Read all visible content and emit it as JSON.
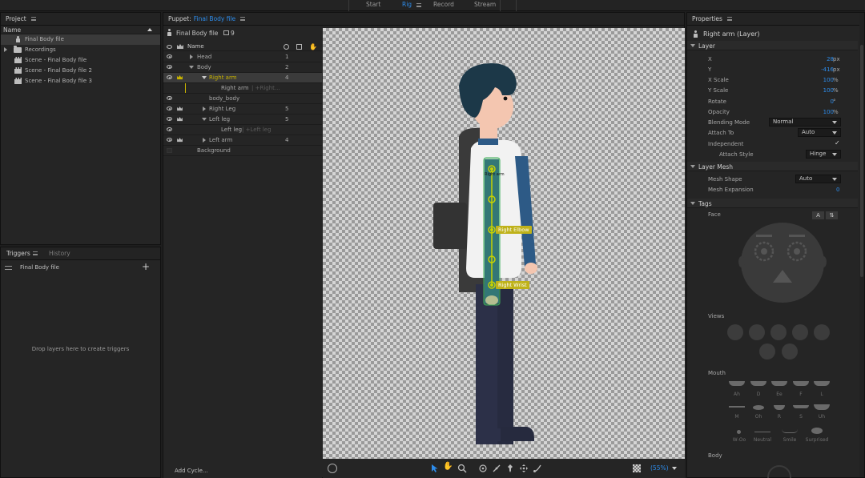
{
  "menu": {
    "tabs": [
      "Start",
      "Rig",
      "Record",
      "Stream"
    ],
    "active": "Rig"
  },
  "project": {
    "title": "Project",
    "column": "Name",
    "items": [
      {
        "label": "Final Body file",
        "icon": "puppet-icon"
      },
      {
        "label": "Recordings",
        "icon": "folder-icon"
      },
      {
        "label": "Scene - Final Body file",
        "icon": "scene-icon"
      },
      {
        "label": "Scene - Final Body file 2",
        "icon": "scene-icon"
      },
      {
        "label": "Scene - Final Body file 3",
        "icon": "scene-icon"
      }
    ]
  },
  "triggers": {
    "tabs": [
      "Triggers",
      "History"
    ],
    "row_label": "Final Body file",
    "empty_text": "Drop layers here to create triggers",
    "add_cycle": "Add Cycle..."
  },
  "puppet": {
    "title_prefix": "Puppet:",
    "title_link": "Final Body file",
    "file_label": "Final Body file",
    "count": "9",
    "col_name": "Name",
    "rows": [
      {
        "name": "Head",
        "num": "1"
      },
      {
        "name": "Body",
        "num": "2"
      },
      {
        "name": "Right arm",
        "num": "4"
      },
      {
        "name": "Right arm",
        "hint": "| +Right..."
      },
      {
        "name": "body_body",
        "num": ""
      },
      {
        "name": "Right Leg",
        "num": "5"
      },
      {
        "name": "Left leg",
        "num": "5"
      },
      {
        "name": "Left leg",
        "hint": "| +Left leg"
      },
      {
        "name": "Left arm",
        "num": "4"
      },
      {
        "name": "Background",
        "num": ""
      }
    ],
    "canvas": {
      "handles": [
        "Right arm",
        "Right Elbow",
        "Right Wrist"
      ],
      "zoom": "(55%)"
    }
  },
  "properties": {
    "title": "Properties",
    "layer_title": "Right arm (Layer)",
    "sections": {
      "layer": "Layer",
      "mesh": "Layer Mesh",
      "tags": "Tags"
    },
    "fields": {
      "x_label": "X",
      "x": "28",
      "x_unit": "px",
      "y_label": "Y",
      "y": "-416",
      "y_unit": "px",
      "xscale_label": "X Scale",
      "xscale": "100",
      "xscale_unit": "%",
      "yscale_label": "Y Scale",
      "yscale": "100",
      "yscale_unit": "%",
      "rotate_label": "Rotate",
      "rotate": "0",
      "rotate_unit": "°",
      "opacity_label": "Opacity",
      "opacity": "100",
      "opacity_unit": "%",
      "blend_label": "Blending Mode",
      "blend": "Normal",
      "attach_label": "Attach To",
      "attach": "Auto",
      "indep_label": "Independent",
      "indep": "✓",
      "attachstyle_label": "Attach Style",
      "attachstyle": "Hinge",
      "meshshape_label": "Mesh Shape",
      "meshshape": "Auto",
      "meshexp_label": "Mesh Expansion",
      "meshexp": "0"
    },
    "tags": {
      "face": "Face",
      "face_btn": "A",
      "views": "Views",
      "mouth": "Mouth",
      "mouth_row1": [
        "Ah",
        "D",
        "Ee",
        "F",
        "L"
      ],
      "mouth_row2": [
        "M",
        "Oh",
        "R",
        "S",
        "Uh"
      ],
      "mouth_row3": [
        "W-Oo",
        "Neutral",
        "Smile",
        "Surprised"
      ],
      "body": "Body"
    }
  },
  "colors": {
    "accent": "#2d8ceb",
    "handle": "#c8d200",
    "selection_green": "#3fae5a"
  }
}
